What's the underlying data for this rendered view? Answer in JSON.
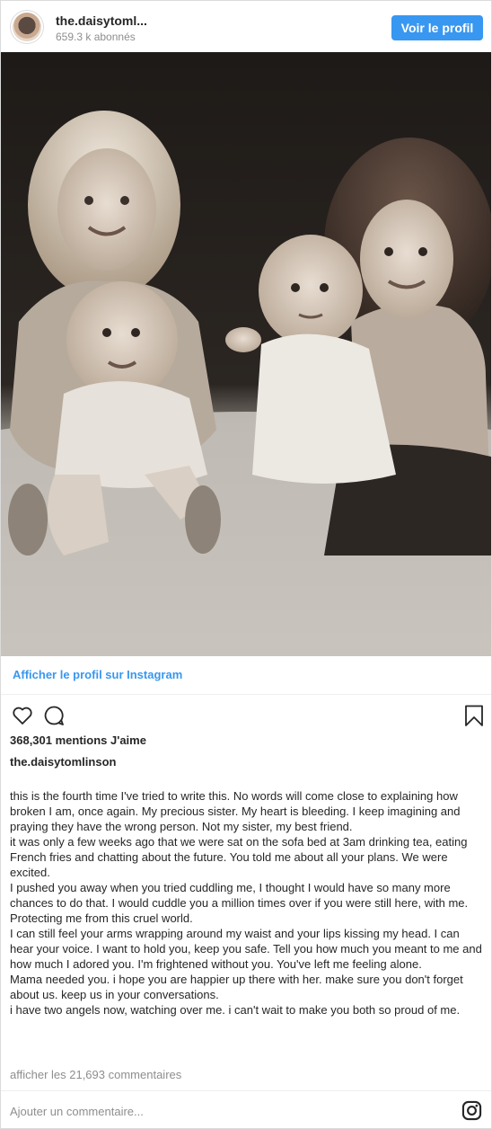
{
  "header": {
    "username": "the.daisytoml...",
    "followers": "659.3 k abonnés",
    "view_profile_label": "Voir le profil"
  },
  "photo": {
    "tone": "sepia-monochrome"
  },
  "link": {
    "label": "Afficher le profil sur Instagram"
  },
  "actions": {
    "like_icon": "heart-icon",
    "comment_icon": "comment-icon",
    "save_icon": "bookmark-icon"
  },
  "likes": "368,301 mentions J'aime",
  "author": "the.daisytomlinson",
  "caption": [
    "this is the fourth time I've tried to write this. No words will come close to explaining how broken I am, once again. My precious sister. My heart is bleeding. I keep imagining and praying they have the wrong person. Not my sister, my best friend.",
    "it was only a few weeks ago that we were sat on the sofa bed at 3am drinking tea, eating French fries and chatting about the future. You told me about all your plans. We were excited.",
    "I pushed you away when you tried cuddling me, I thought I would have so many more chances to do that. I would cuddle you a million times over if you were still here, with me. Protecting me from this cruel world.",
    "I can still feel your arms wrapping around my waist and your lips kissing my head. I can hear your voice. I want to hold you, keep you safe. Tell you how much you meant to me and how much I adored you. I'm frightened without you. You've left me feeling alone.",
    "Mama needed you. i hope you are happier up there with her. make sure you don't forget about us. keep us in your conversations.",
    "i have two angels now, watching over me. i can't wait to make you both so proud of me."
  ],
  "comments_link": "afficher les 21,693 commentaires",
  "comment_placeholder": "Ajouter un commentaire...",
  "footer_icon": "instagram-logo-icon",
  "colors": {
    "accent": "#3897f0",
    "text": "#262626",
    "muted": "#8e8e8e",
    "border": "#dbdbdb"
  }
}
